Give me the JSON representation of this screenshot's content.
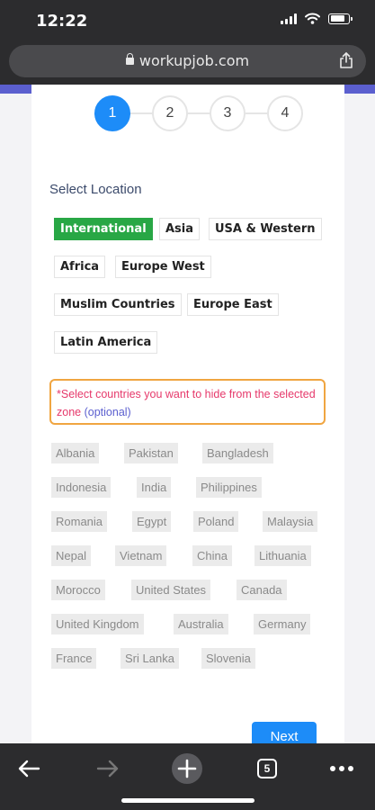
{
  "status_bar": {
    "time": "12:22"
  },
  "browser": {
    "url": "workupjob.com"
  },
  "stepper": {
    "steps": [
      "1",
      "2",
      "3",
      "4"
    ],
    "active_step": 1
  },
  "location": {
    "title": "Select Location",
    "zones": [
      "International",
      "Asia",
      "USA & Western",
      "Africa",
      "Europe West",
      "Muslim Countries",
      "Europe East",
      "Latin America"
    ],
    "selected_zone": "International"
  },
  "notice": {
    "text": "*Select countries you want to hide from the selected zone",
    "optional": "(optional)"
  },
  "countries": [
    "Albania",
    "Pakistan",
    "Bangladesh",
    "Indonesia",
    "India",
    "Philippines",
    "Romania",
    "Egypt",
    "Poland",
    "Malaysia",
    "Nepal",
    "Vietnam",
    "China",
    "Lithuania",
    "Morocco",
    "United States",
    "Canada",
    "United Kingdom",
    "Australia",
    "Germany",
    "France",
    "Sri Lanka",
    "Slovenia"
  ],
  "actions": {
    "next": "Next"
  },
  "toolbar": {
    "tab_count": "5"
  },
  "colors": {
    "accent": "#1d8cf8",
    "selected_zone": "#28a745",
    "notice_border": "#f0a541",
    "notice_text": "#e6396b",
    "brand_band": "#5b5fcf"
  }
}
